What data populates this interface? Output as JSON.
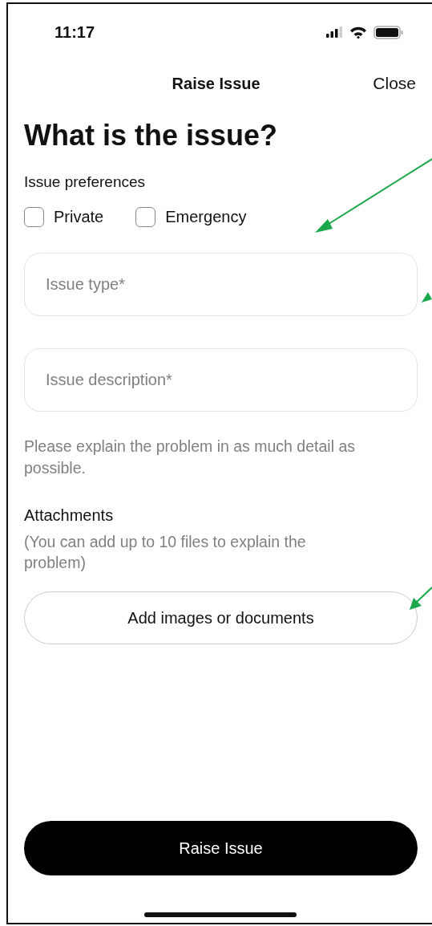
{
  "status_bar": {
    "time": "11:17"
  },
  "nav": {
    "title": "Raise Issue",
    "close": "Close"
  },
  "heading": "What is the issue?",
  "preferences": {
    "label": "Issue preferences",
    "options": [
      {
        "label": "Private",
        "checked": false
      },
      {
        "label": "Emergency",
        "checked": false
      }
    ]
  },
  "fields": [
    {
      "placeholder": "Issue type*"
    },
    {
      "placeholder": "Issue description*"
    }
  ],
  "hint": "Please explain the problem in as much detail as possible.",
  "attachments": {
    "label": "Attachments",
    "note": "(You can add up to 10 files to explain the problem)",
    "button": "Add images or documents"
  },
  "submit": "Raise Issue"
}
